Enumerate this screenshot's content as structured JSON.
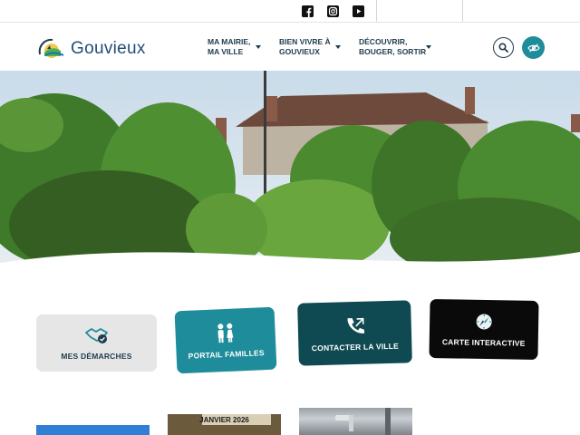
{
  "social": {
    "facebook_icon": "facebook-icon",
    "instagram_icon": "instagram-icon",
    "youtube_icon": "youtube-icon"
  },
  "header": {
    "logo_text": "Gouvieux",
    "nav": [
      {
        "line1": "MA MAIRIE,",
        "line2": "MA VILLE"
      },
      {
        "line1": "BIEN VIVRE À",
        "line2": "GOUVIEUX"
      },
      {
        "line1": "DÉCOUVRIR,",
        "line2": "BOUGER, SORTIR"
      }
    ],
    "search_icon": "search-icon",
    "accessibility_icon": "eye-off-icon"
  },
  "tiles": [
    {
      "label": "MES DÉMARCHES",
      "icon": "handshake-icon"
    },
    {
      "label": "PORTAIL FAMILLES",
      "icon": "family-icon"
    },
    {
      "label": "CONTACTER LA VILLE",
      "icon": "phone-icon"
    },
    {
      "label": "CARTE INTERACTIVE",
      "icon": "compass-icon"
    }
  ],
  "cards": {
    "card2_title": "JANVIER 2026"
  },
  "colors": {
    "primary_dark": "#1f3b4d",
    "teal": "#1e8c9a",
    "dark_teal": "#0f4a52",
    "tile_grey": "#e6e6e6",
    "black": "#0a0a0a"
  }
}
